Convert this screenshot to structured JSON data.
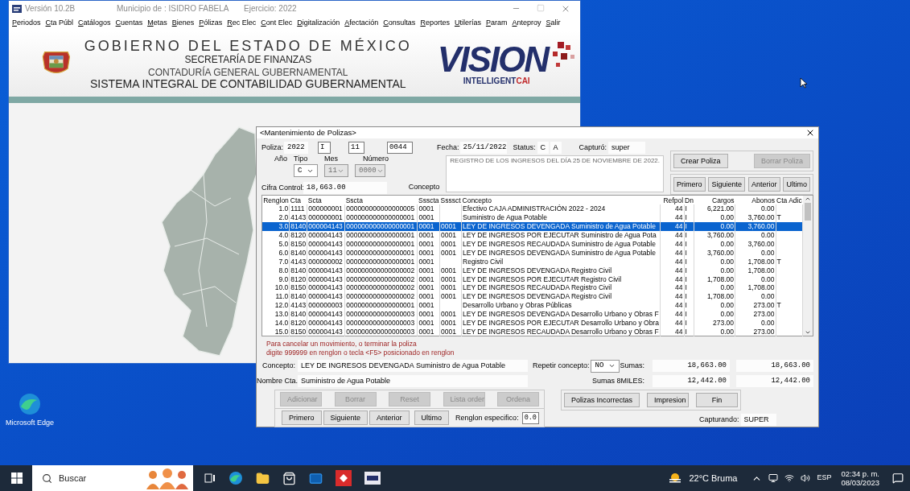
{
  "main_window": {
    "title_items": [
      "Versión 10.2B",
      "Municipio de : ISIDRO FABELA",
      "Ejercicio: 2022"
    ],
    "menu": [
      "Periodos",
      "Cta Públ",
      "Catálogos",
      "Cuentas",
      "Metas",
      "Bienes",
      "Pólizas",
      "Rec Elec",
      "Cont Elec",
      "Digitalización",
      "Afectación",
      "Consultas",
      "Reportes",
      "Utilerías",
      "Param",
      "Anteproy",
      "Salir"
    ],
    "banner": [
      "GOBIERNO DEL ESTADO DE MÉXICO",
      "SECRETARÍA DE FINANZAS",
      "CONTADURÍA GENERAL GUBERNAMENTAL",
      "SISTEMA INTEGRAL DE CONTABILIDAD GUBERNAMENTAL"
    ],
    "logo": {
      "word": "VISION",
      "tagline": "INTELLIGENT",
      "brand": "CAI"
    }
  },
  "desktop": {
    "icons": [
      {
        "label": "Microsoft Edge"
      }
    ]
  },
  "dialog": {
    "title": "<Mantenimiento de Polizas>",
    "poliza": {
      "label": "Poliza:",
      "year": "2022",
      "tipo": "I",
      "mes": "11",
      "numero": "0044"
    },
    "fecha": {
      "label": "Fecha:",
      "value": "25/11/2022"
    },
    "status": {
      "label": "Status:",
      "values": [
        "C",
        "A"
      ]
    },
    "capturo": {
      "label": "Capturó:",
      "value": "super"
    },
    "sub_labels": [
      "Año",
      "Tipo",
      "Mes",
      "Número"
    ],
    "selects": [
      {
        "value": "C",
        "disabled": false
      },
      {
        "value": "11",
        "disabled": true
      },
      {
        "value": "0000",
        "disabled": true
      }
    ],
    "cifra_control": {
      "label": "Cifra Control:",
      "value": "18,663.00"
    },
    "concepto": {
      "label": "Concepto",
      "value": "REGISTRO DE LOS INGRESOS DEL DÍA 25 DE NOVIEMBRE DE 2022."
    },
    "action_buttons": [
      {
        "label": "Crear Poliza",
        "disabled": false
      },
      {
        "label": "Borrar Poliza",
        "disabled": true
      }
    ],
    "nav_buttons": [
      {
        "label": "Primero",
        "disabled": false
      },
      {
        "label": "Siguiente",
        "disabled": false
      },
      {
        "label": "Anterior",
        "disabled": false
      },
      {
        "label": "Ultimo",
        "disabled": false
      }
    ],
    "table": {
      "columns": [
        "Renglon",
        "Cta",
        "Scta",
        "Sscta",
        "Ssscta",
        "Ssssct",
        "Concepto",
        "Refpol",
        "Dn",
        "Cargos",
        "Abonos",
        "Cta Adic"
      ],
      "rows": [
        {
          "renglon": "1.0",
          "cta": "1111",
          "scta": "000000001",
          "sscta": "000000000000000005",
          "ssscta": "0001",
          "concepto": "Efectivo CAJA ADMINISTRACIÓN 2022 - 2024",
          "refpol": "44",
          "dn": "I",
          "cargos": "6,221.00",
          "abonos": "0.00",
          "selected": false
        },
        {
          "renglon": "2.0",
          "cta": "4143",
          "scta": "000000001",
          "sscta": "000000000000000001",
          "ssscta": "0001",
          "concepto": "Suministro de Agua Potable",
          "refpol": "44",
          "dn": "I",
          "cargos": "0.00",
          "abonos": "3,760.00",
          "cta_adic": "T",
          "selected": false
        },
        {
          "renglon": "3.0",
          "cta": "8140",
          "scta": "000004143",
          "sscta": "000000000000000001",
          "ssscta": "0001",
          "sssscta": "0001",
          "concepto": "LEY DE INGRESOS DEVENGADA Suministro de Agua Potable",
          "refpol": "44",
          "dn": "I",
          "cargos": "0.00",
          "abonos": "3,760.00",
          "selected": true
        },
        {
          "renglon": "4.0",
          "cta": "8120",
          "scta": "000004143",
          "sscta": "000000000000000001",
          "ssscta": "0001",
          "sssscta": "0001",
          "concepto": "LEY DE INGRESOS POR EJECUTAR Suministro de Agua Pota",
          "refpol": "44",
          "dn": "I",
          "cargos": "3,760.00",
          "abonos": "0.00",
          "selected": false
        },
        {
          "renglon": "5.0",
          "cta": "8150",
          "scta": "000004143",
          "sscta": "000000000000000001",
          "ssscta": "0001",
          "sssscta": "0001",
          "concepto": "LEY DE INGRESOS RECAUDADA Suministro de Agua Potable",
          "refpol": "44",
          "dn": "I",
          "cargos": "0.00",
          "abonos": "3,760.00",
          "selected": false
        },
        {
          "renglon": "6.0",
          "cta": "8140",
          "scta": "000004143",
          "sscta": "000000000000000001",
          "ssscta": "0001",
          "sssscta": "0001",
          "concepto": "LEY DE INGRESOS DEVENGADA Suministro de Agua Potable",
          "refpol": "44",
          "dn": "I",
          "cargos": "3,760.00",
          "abonos": "0.00",
          "selected": false
        },
        {
          "renglon": "7.0",
          "cta": "4143",
          "scta": "000000002",
          "sscta": "000000000000000001",
          "ssscta": "0001",
          "concepto": "Registro Civil",
          "refpol": "44",
          "dn": "I",
          "cargos": "0.00",
          "abonos": "1,708.00",
          "cta_adic": "T",
          "selected": false
        },
        {
          "renglon": "8.0",
          "cta": "8140",
          "scta": "000004143",
          "sscta": "000000000000000002",
          "ssscta": "0001",
          "sssscta": "0001",
          "concepto": "LEY DE INGRESOS DEVENGADA Registro Civil",
          "refpol": "44",
          "dn": "I",
          "cargos": "0.00",
          "abonos": "1,708.00",
          "selected": false
        },
        {
          "renglon": "9.0",
          "cta": "8120",
          "scta": "000004143",
          "sscta": "000000000000000002",
          "ssscta": "0001",
          "sssscta": "0001",
          "concepto": "LEY DE INGRESOS POR EJECUTAR Registro Civil",
          "refpol": "44",
          "dn": "I",
          "cargos": "1,708.00",
          "abonos": "0.00",
          "selected": false
        },
        {
          "renglon": "10.0",
          "cta": "8150",
          "scta": "000004143",
          "sscta": "000000000000000002",
          "ssscta": "0001",
          "sssscta": "0001",
          "concepto": "LEY DE INGRESOS RECAUDADA Registro Civil",
          "refpol": "44",
          "dn": "I",
          "cargos": "0.00",
          "abonos": "1,708.00",
          "selected": false
        },
        {
          "renglon": "11.0",
          "cta": "8140",
          "scta": "000004143",
          "sscta": "000000000000000002",
          "ssscta": "0001",
          "sssscta": "0001",
          "concepto": "LEY DE INGRESOS DEVENGADA Registro Civil",
          "refpol": "44",
          "dn": "I",
          "cargos": "1,708.00",
          "abonos": "0.00",
          "selected": false
        },
        {
          "renglon": "12.0",
          "cta": "4143",
          "scta": "000000003",
          "sscta": "000000000000000001",
          "ssscta": "0001",
          "concepto": "Desarrollo Urbano y Obras Públicas",
          "refpol": "44",
          "dn": "I",
          "cargos": "0.00",
          "abonos": "273.00",
          "cta_adic": "T",
          "selected": false
        },
        {
          "renglon": "13.0",
          "cta": "8140",
          "scta": "000004143",
          "sscta": "000000000000000003",
          "ssscta": "0001",
          "sssscta": "0001",
          "concepto": "LEY DE INGRESOS DEVENGADA Desarrollo Urbano y Obras F",
          "refpol": "44",
          "dn": "I",
          "cargos": "0.00",
          "abonos": "273.00",
          "selected": false
        },
        {
          "renglon": "14.0",
          "cta": "8120",
          "scta": "000004143",
          "sscta": "000000000000000003",
          "ssscta": "0001",
          "sssscta": "0001",
          "concepto": "LEY DE INGRESOS POR EJECUTAR Desarrollo Urbano y Obra",
          "refpol": "44",
          "dn": "I",
          "cargos": "273.00",
          "abonos": "0.00",
          "selected": false
        },
        {
          "renglon": "15.0",
          "cta": "8150",
          "scta": "000004143",
          "sscta": "000000000000000003",
          "ssscta": "0001",
          "sssscta": "0001",
          "concepto": "LEY DE INGRESOS RECAUDADA Desarrollo Urbano y Obras F",
          "refpol": "44",
          "dn": "I",
          "cargos": "0.00",
          "abonos": "273.00",
          "selected": false
        }
      ]
    },
    "notice": [
      "Para cancelar un movimiento, o terminar la poliza",
      "digite 999999 en renglon o tecla <F5> posicionado en renglon"
    ],
    "concepto_field": {
      "label": "Concepto:",
      "value": "LEY DE INGRESOS DEVENGADA Suministro de Agua Potable"
    },
    "nombre_cta": {
      "label": "Nombre Cta.:",
      "value": "Suministro de Agua Potable"
    },
    "repetir": {
      "label": "Repetir concepto:",
      "value": "NO"
    },
    "sumas": [
      {
        "label": "Sumas:",
        "values": [
          "18,663.00",
          "18,663.00"
        ]
      },
      {
        "label": "Sumas 8MILES:",
        "values": [
          "12,442.00",
          "12,442.00"
        ]
      }
    ],
    "edit_buttons": [
      {
        "label": "Adicionar",
        "disabled": true
      },
      {
        "label": "Borrar",
        "disabled": true
      },
      {
        "label": "Reset",
        "disabled": true
      },
      {
        "label": "Lista order",
        "disabled": true
      },
      {
        "label": "Ordena",
        "disabled": true
      }
    ],
    "row_nav_buttons": [
      {
        "label": "Primero",
        "disabled": false
      },
      {
        "label": "Siguiente",
        "disabled": false
      },
      {
        "label": "Anterior",
        "disabled": false
      },
      {
        "label": "Ultimo",
        "disabled": false
      }
    ],
    "renglon_especifico": {
      "label": "Renglon especifico:",
      "value": "0.0"
    },
    "report_buttons": [
      {
        "label": "Polizas Incorrectas",
        "disabled": false
      },
      {
        "label": "Impresion",
        "disabled": false
      },
      {
        "label": "Fin",
        "disabled": false
      }
    ],
    "capturando": {
      "label": "Capturando:",
      "value": "SUPER"
    }
  },
  "taskbar": {
    "search": {
      "placeholder": "Buscar"
    },
    "weather": "22°C Bruma",
    "language": "ESP",
    "time": "02:34 p. m.",
    "date": "08/03/2023"
  }
}
